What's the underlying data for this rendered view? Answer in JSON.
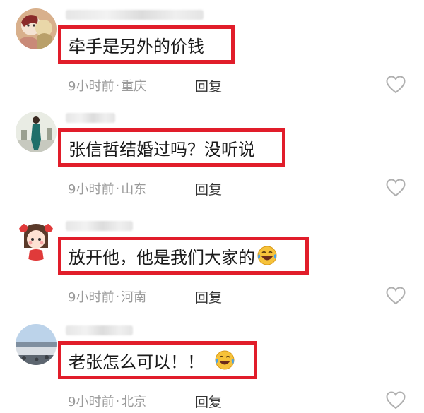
{
  "comments": [
    {
      "text": "牵手是另外的价钱",
      "time": "9小时前",
      "separator": "·",
      "location": "重庆",
      "reply_label": "回复",
      "has_emoji": false,
      "avatar_icon": "cartoon-avatar-icon"
    },
    {
      "text": "张信哲结婚过吗？没听说",
      "time": "9小时前",
      "separator": "·",
      "location": "山东",
      "reply_label": "回复",
      "has_emoji": false,
      "avatar_icon": "person-photo-avatar-icon"
    },
    {
      "text": "放开他，他是我们大家的",
      "time": "9小时前",
      "separator": "·",
      "location": "河南",
      "reply_label": "回复",
      "has_emoji": true,
      "emoji_icon": "laughing-tears-emoji-icon",
      "avatar_icon": "cartoon-girl-avatar-icon"
    },
    {
      "text": "老张怎么可以！！",
      "time": "9小时前",
      "separator": "·",
      "location": "北京",
      "reply_label": "回复",
      "has_emoji": true,
      "emoji_icon": "laughing-tears-emoji-icon",
      "avatar_icon": "landscape-avatar-icon"
    }
  ],
  "colors": {
    "highlight_border": "#e11d2a",
    "meta_text": "#9a9a9a",
    "reply_text": "#333333",
    "like_icon": "#b0b0b0"
  }
}
